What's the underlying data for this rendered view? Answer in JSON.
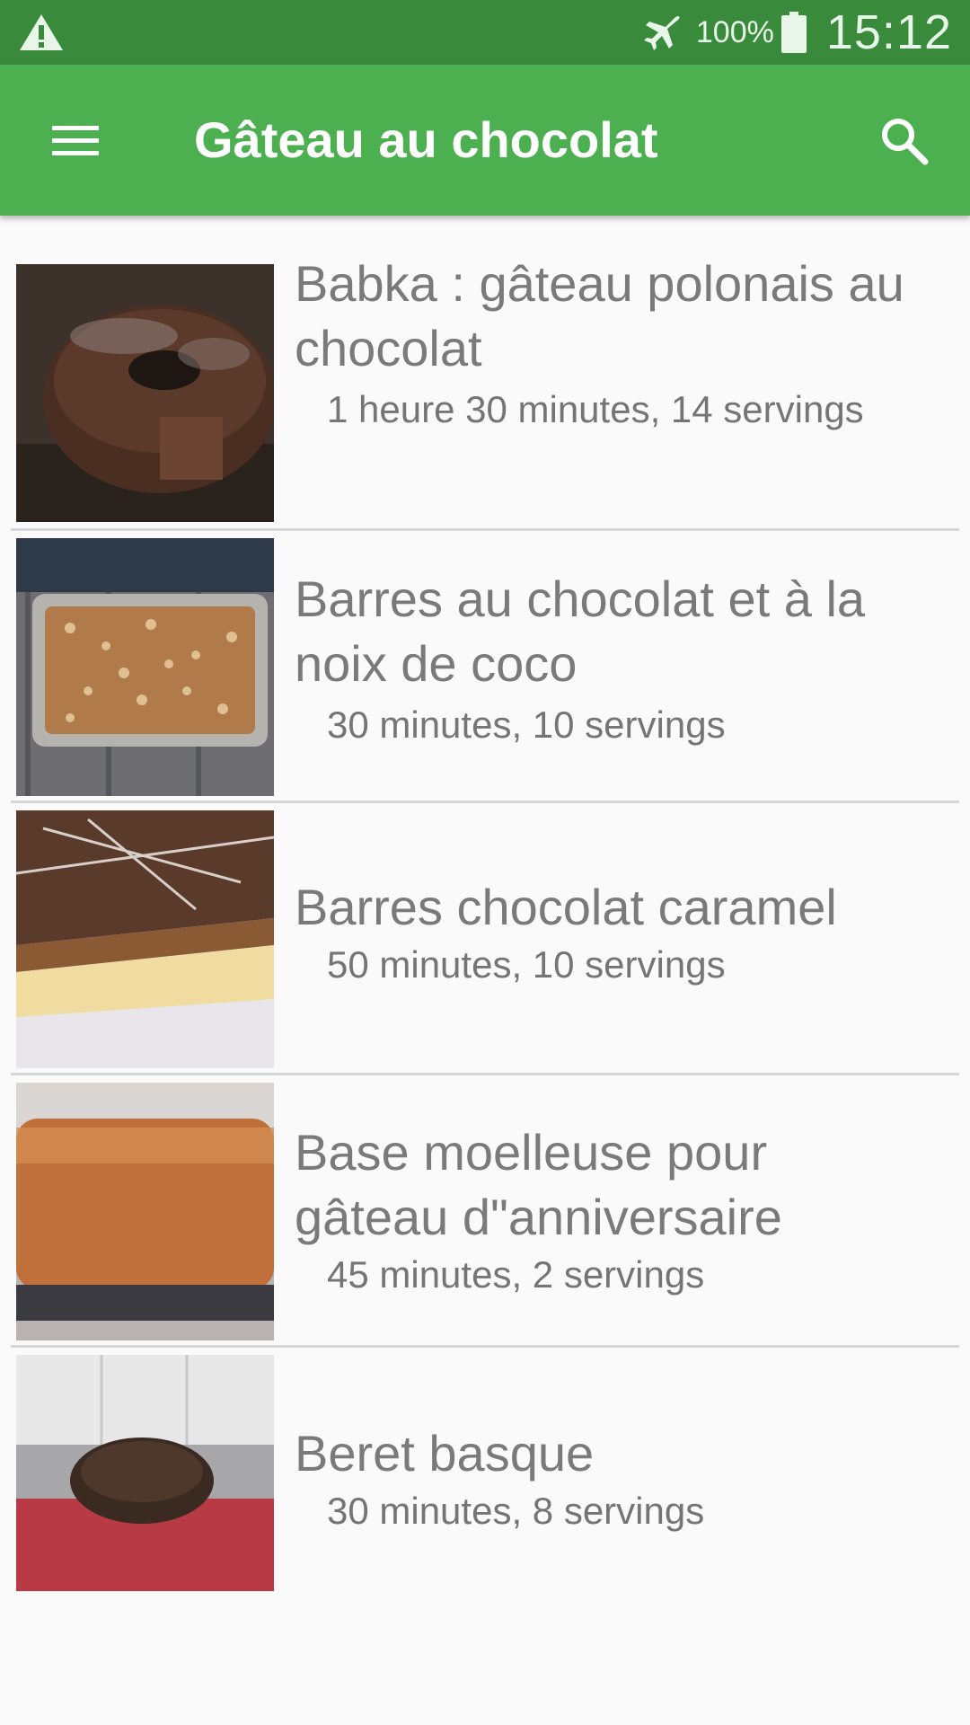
{
  "status_bar": {
    "battery": "100%",
    "time": "15:12",
    "icons": [
      "warning-icon",
      "airplane-icon",
      "battery-icon"
    ]
  },
  "app_bar": {
    "title": "Gâteau au chocolat",
    "menu_icon": "menu-icon",
    "search_icon": "search-icon",
    "color": "#4caf50"
  },
  "recipes": [
    {
      "title_line1": "Babka : gâteau polonais au",
      "title_line2": "chocolat",
      "meta": "1 heure 30 minutes, 14 servings"
    },
    {
      "title_line1": "Barres au chocolat et à la",
      "title_line2": "noix de coco",
      "meta": "30 minutes, 10 servings"
    },
    {
      "title_line1": "Barres chocolat caramel",
      "title_line2": "",
      "meta": "50 minutes, 10 servings"
    },
    {
      "title_line1": "Base moelleuse pour",
      "title_line2": "gâteau d\"anniversaire",
      "meta": "45 minutes, 2 servings"
    },
    {
      "title_line1": "Beret basque",
      "title_line2": "",
      "meta": "30 minutes, 8 servings"
    }
  ]
}
